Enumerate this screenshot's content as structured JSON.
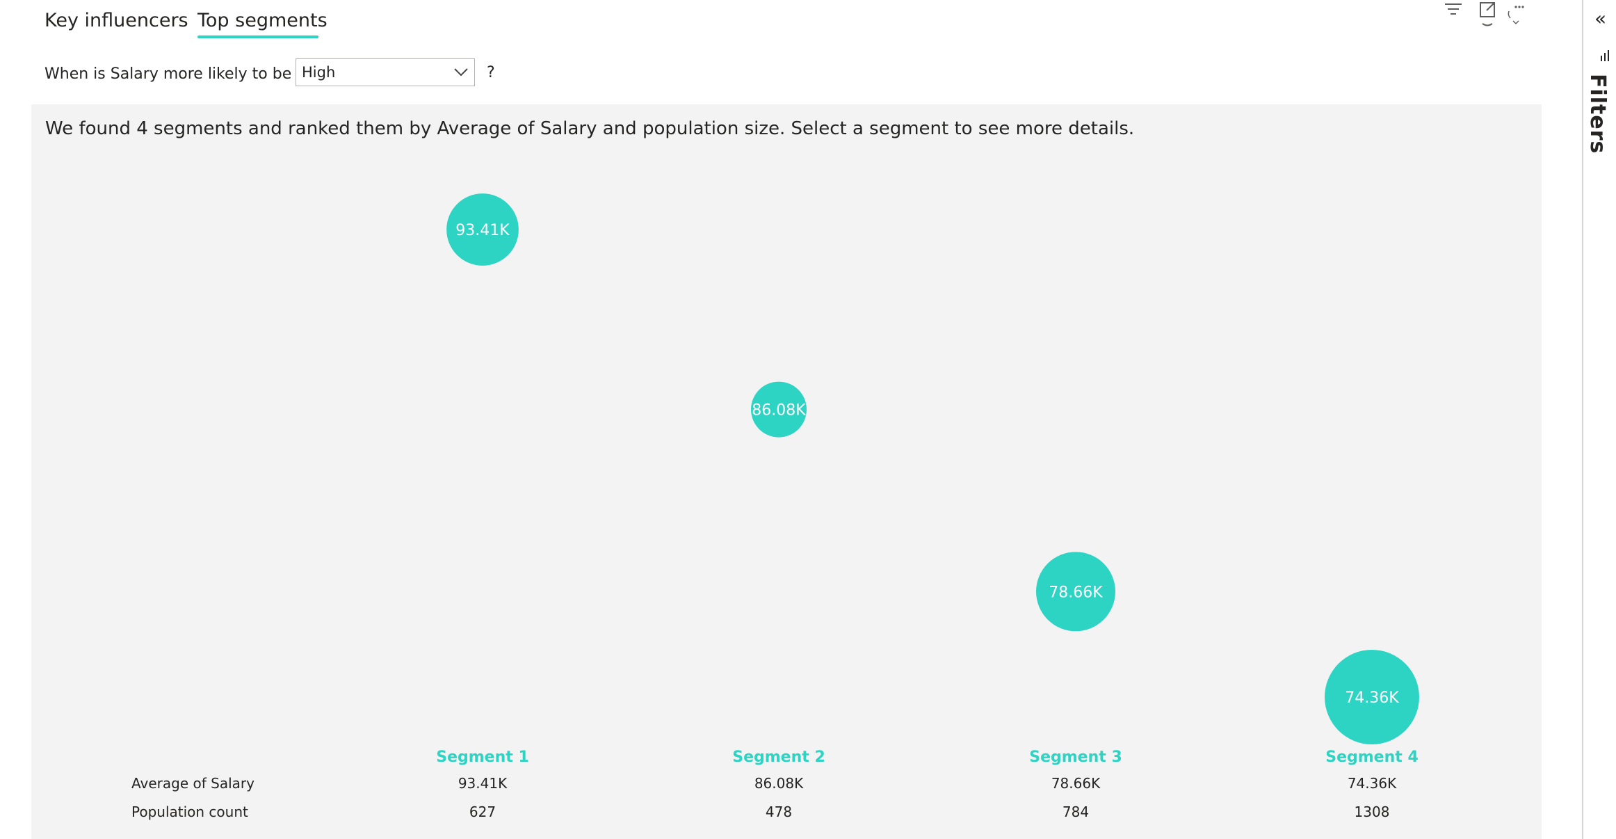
{
  "tabs": [
    {
      "label": "Key influencers"
    },
    {
      "label": "Top segments",
      "active": true
    }
  ],
  "question": {
    "prefix": "When is Salary more likely to be",
    "dropdown_value": "High",
    "suffix": "?"
  },
  "summary": "We found 4 segments and ranked them by Average of Salary and population size. Select a segment to see more details.",
  "chart_data": {
    "type": "scatter",
    "categories": [
      "Segment 1",
      "Segment 2",
      "Segment 3",
      "Segment 4"
    ],
    "series": [
      {
        "name": "Average of Salary",
        "values": [
          93.41,
          86.08,
          78.66,
          74.36
        ]
      },
      {
        "name": "Population count",
        "values": [
          627,
          478,
          784,
          1308
        ]
      }
    ],
    "bubble_labels": [
      "93.41K",
      "86.08K",
      "78.66K",
      "74.36K"
    ],
    "color": "#2dd4c4"
  },
  "table": {
    "row_labels": [
      "Average of Salary",
      "Population count"
    ],
    "segments": [
      {
        "name": "Segment 1",
        "avg": "93.41K",
        "count": "627"
      },
      {
        "name": "Segment 2",
        "avg": "86.08K",
        "count": "478"
      },
      {
        "name": "Segment 3",
        "avg": "78.66K",
        "count": "784"
      },
      {
        "name": "Segment 4",
        "avg": "74.36K",
        "count": "1308"
      }
    ]
  },
  "sidebar": {
    "label": "Filters",
    "collapse_glyph": "«"
  },
  "icons": [
    "filter-icon",
    "focus-mode-icon",
    "more-options-icon",
    "chevron-down-icon",
    "collapse-icon"
  ],
  "colors": {
    "accent": "#2dd4c4",
    "panel_bg": "#f3f3f3",
    "text": "#252423"
  }
}
